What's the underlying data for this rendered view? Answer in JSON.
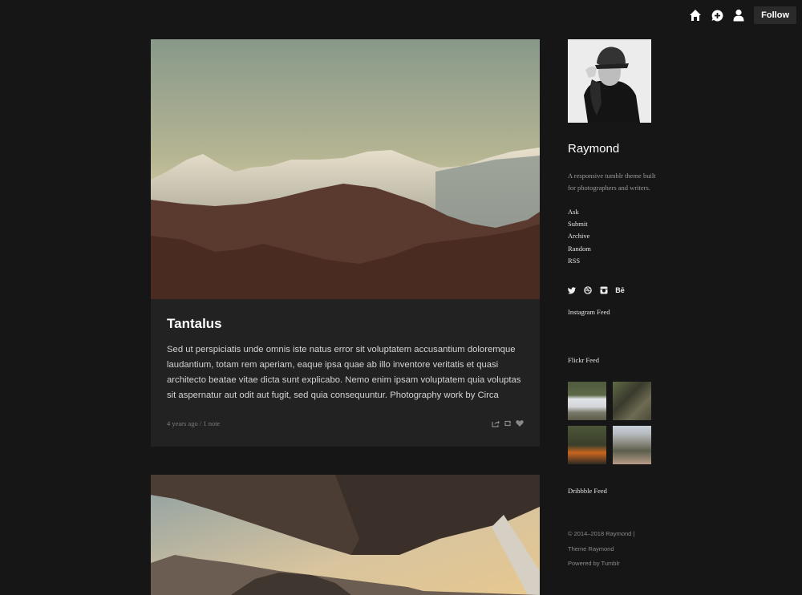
{
  "topbar": {
    "icons": [
      "home-icon",
      "new-post-icon",
      "account-icon"
    ],
    "follow_label": "Follow"
  },
  "posts": [
    {
      "image_alt": "Mountain range at dusk",
      "title": "Tantalus",
      "body": "Sed ut perspiciatis unde omnis iste natus error sit voluptatem accusantium doloremque laudantium, totam rem aperiam, eaque ipsa quae ab illo inventore veritatis et quasi architecto beatae vitae dicta sunt explicabo. Nemo enim ipsam voluptatem quia voluptas sit aspernatur aut odit aut fugit, sed quia consequuntur. Photography work by Circa",
      "meta": "4 years ago / 1 note",
      "actions": [
        "share-icon",
        "reblog-icon",
        "like-icon"
      ]
    },
    {
      "image_alt": "View under airplane wing over mountains"
    }
  ],
  "sidebar": {
    "blog_name": "Raymond",
    "description": "A responsive tumblr theme built for photographers and writers.",
    "links": [
      "Ask",
      "Submit",
      "Archive",
      "Random",
      "RSS"
    ],
    "social": [
      "twitter-icon",
      "dribbble-icon",
      "instagram-icon",
      "behance-icon"
    ],
    "behance_glyph": "Bē",
    "instagram_feed_title": "Instagram Feed",
    "flickr_feed_title": "Flickr Feed",
    "dribbble_feed_title": "Dribbble Feed",
    "footer": {
      "copyright": "© 2014–2018 Raymond |",
      "theme": "Theme Raymond",
      "powered": "Powered by Tumblr"
    }
  }
}
